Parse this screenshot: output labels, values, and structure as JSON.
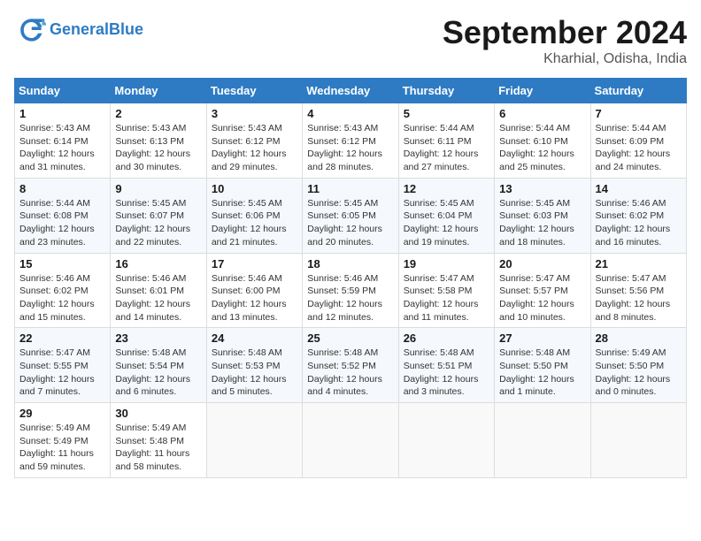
{
  "header": {
    "logo_general": "General",
    "logo_blue": "Blue",
    "month": "September 2024",
    "location": "Kharhial, Odisha, India"
  },
  "days_of_week": [
    "Sunday",
    "Monday",
    "Tuesday",
    "Wednesday",
    "Thursday",
    "Friday",
    "Saturday"
  ],
  "weeks": [
    [
      {
        "day": 1,
        "info": "Sunrise: 5:43 AM\nSunset: 6:14 PM\nDaylight: 12 hours\nand 31 minutes."
      },
      {
        "day": 2,
        "info": "Sunrise: 5:43 AM\nSunset: 6:13 PM\nDaylight: 12 hours\nand 30 minutes."
      },
      {
        "day": 3,
        "info": "Sunrise: 5:43 AM\nSunset: 6:12 PM\nDaylight: 12 hours\nand 29 minutes."
      },
      {
        "day": 4,
        "info": "Sunrise: 5:43 AM\nSunset: 6:12 PM\nDaylight: 12 hours\nand 28 minutes."
      },
      {
        "day": 5,
        "info": "Sunrise: 5:44 AM\nSunset: 6:11 PM\nDaylight: 12 hours\nand 27 minutes."
      },
      {
        "day": 6,
        "info": "Sunrise: 5:44 AM\nSunset: 6:10 PM\nDaylight: 12 hours\nand 25 minutes."
      },
      {
        "day": 7,
        "info": "Sunrise: 5:44 AM\nSunset: 6:09 PM\nDaylight: 12 hours\nand 24 minutes."
      }
    ],
    [
      {
        "day": 8,
        "info": "Sunrise: 5:44 AM\nSunset: 6:08 PM\nDaylight: 12 hours\nand 23 minutes."
      },
      {
        "day": 9,
        "info": "Sunrise: 5:45 AM\nSunset: 6:07 PM\nDaylight: 12 hours\nand 22 minutes."
      },
      {
        "day": 10,
        "info": "Sunrise: 5:45 AM\nSunset: 6:06 PM\nDaylight: 12 hours\nand 21 minutes."
      },
      {
        "day": 11,
        "info": "Sunrise: 5:45 AM\nSunset: 6:05 PM\nDaylight: 12 hours\nand 20 minutes."
      },
      {
        "day": 12,
        "info": "Sunrise: 5:45 AM\nSunset: 6:04 PM\nDaylight: 12 hours\nand 19 minutes."
      },
      {
        "day": 13,
        "info": "Sunrise: 5:45 AM\nSunset: 6:03 PM\nDaylight: 12 hours\nand 18 minutes."
      },
      {
        "day": 14,
        "info": "Sunrise: 5:46 AM\nSunset: 6:02 PM\nDaylight: 12 hours\nand 16 minutes."
      }
    ],
    [
      {
        "day": 15,
        "info": "Sunrise: 5:46 AM\nSunset: 6:02 PM\nDaylight: 12 hours\nand 15 minutes."
      },
      {
        "day": 16,
        "info": "Sunrise: 5:46 AM\nSunset: 6:01 PM\nDaylight: 12 hours\nand 14 minutes."
      },
      {
        "day": 17,
        "info": "Sunrise: 5:46 AM\nSunset: 6:00 PM\nDaylight: 12 hours\nand 13 minutes."
      },
      {
        "day": 18,
        "info": "Sunrise: 5:46 AM\nSunset: 5:59 PM\nDaylight: 12 hours\nand 12 minutes."
      },
      {
        "day": 19,
        "info": "Sunrise: 5:47 AM\nSunset: 5:58 PM\nDaylight: 12 hours\nand 11 minutes."
      },
      {
        "day": 20,
        "info": "Sunrise: 5:47 AM\nSunset: 5:57 PM\nDaylight: 12 hours\nand 10 minutes."
      },
      {
        "day": 21,
        "info": "Sunrise: 5:47 AM\nSunset: 5:56 PM\nDaylight: 12 hours\nand 8 minutes."
      }
    ],
    [
      {
        "day": 22,
        "info": "Sunrise: 5:47 AM\nSunset: 5:55 PM\nDaylight: 12 hours\nand 7 minutes."
      },
      {
        "day": 23,
        "info": "Sunrise: 5:48 AM\nSunset: 5:54 PM\nDaylight: 12 hours\nand 6 minutes."
      },
      {
        "day": 24,
        "info": "Sunrise: 5:48 AM\nSunset: 5:53 PM\nDaylight: 12 hours\nand 5 minutes."
      },
      {
        "day": 25,
        "info": "Sunrise: 5:48 AM\nSunset: 5:52 PM\nDaylight: 12 hours\nand 4 minutes."
      },
      {
        "day": 26,
        "info": "Sunrise: 5:48 AM\nSunset: 5:51 PM\nDaylight: 12 hours\nand 3 minutes."
      },
      {
        "day": 27,
        "info": "Sunrise: 5:48 AM\nSunset: 5:50 PM\nDaylight: 12 hours\nand 1 minute."
      },
      {
        "day": 28,
        "info": "Sunrise: 5:49 AM\nSunset: 5:50 PM\nDaylight: 12 hours\nand 0 minutes."
      }
    ],
    [
      {
        "day": 29,
        "info": "Sunrise: 5:49 AM\nSunset: 5:49 PM\nDaylight: 11 hours\nand 59 minutes."
      },
      {
        "day": 30,
        "info": "Sunrise: 5:49 AM\nSunset: 5:48 PM\nDaylight: 11 hours\nand 58 minutes."
      },
      null,
      null,
      null,
      null,
      null
    ]
  ]
}
